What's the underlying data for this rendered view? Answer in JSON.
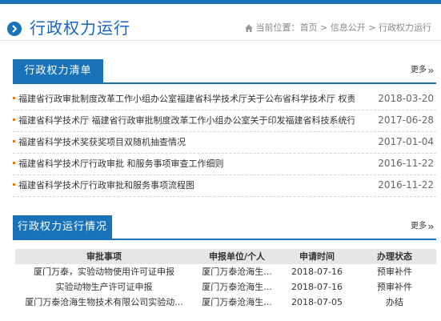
{
  "header": {
    "title": "行政权力运行",
    "breadcrumb_label": "当前位置：",
    "breadcrumb": [
      "首页",
      "信息公开",
      "行政权力运行"
    ],
    "breadcrumb_separator": " > "
  },
  "list_section": {
    "title": "行政权力清单",
    "more": "更多",
    "items": [
      {
        "title": "福建省行政审批制度改革工作小组办公室福建省科学技术厅关于公布省科学技术厅 权责...",
        "date": "2018-03-20"
      },
      {
        "title": "福建省科学技术厅 福建省行政审批制度改革工作小组办公室关于印发福建省科技系统行...",
        "date": "2017-06-28"
      },
      {
        "title": "福建省科学技术奖获奖项目双随机抽查情况",
        "date": "2017-01-04"
      },
      {
        "title": "福建省科学技术厅行政审批 和服务事项审查工作细则",
        "date": "2016-11-22"
      },
      {
        "title": "福建省科学技术厅行政审批和服务事项流程图",
        "date": "2016-11-22"
      }
    ]
  },
  "status_section": {
    "title": "行政权力运行情况",
    "more": "更多",
    "columns": [
      "审批事项",
      "申报单位/个人",
      "申请时间",
      "办理状态"
    ],
    "rows": [
      [
        "厦门万泰，实验动物使用许可证申报",
        "厦门万泰沧海生...",
        "2018-07-16",
        "预审补件"
      ],
      [
        "实验动物生产许可证申报",
        "厦门万泰沧海生...",
        "2018-07-16",
        "预审补件"
      ],
      [
        "厦门万泰沧海生物技术有限公司实验动...",
        "厦门万泰沧海生...",
        "2018-07-05",
        "办结"
      ]
    ]
  },
  "colors": {
    "accent": "#1a73b8",
    "bullet": "#f07800",
    "title": "#1565c0"
  },
  "icons": {
    "header": "circle-arrow-icon",
    "breadcrumb": "home-icon",
    "more": "double-chevron-icon"
  }
}
